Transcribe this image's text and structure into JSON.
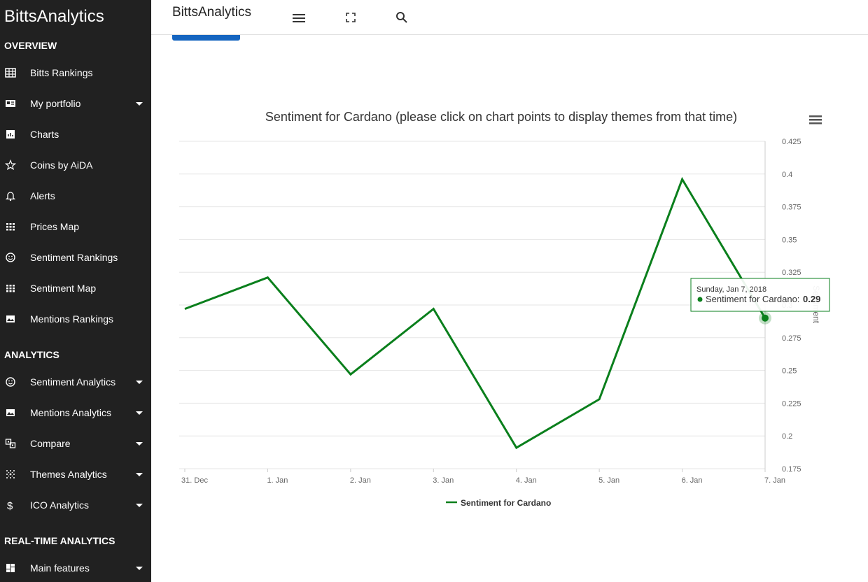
{
  "sidebar": {
    "brand": "BittsAnalytics",
    "sections": {
      "overview": "OVERVIEW",
      "analytics": "ANALYTICS",
      "realtime": "REAL-TIME ANALYTICS"
    },
    "overview_items": [
      {
        "label": "Bitts Rankings",
        "icon": "table-icon",
        "has_caret": false
      },
      {
        "label": "My portfolio",
        "icon": "id-card-icon",
        "has_caret": true
      },
      {
        "label": "Charts",
        "icon": "bar-chart-icon",
        "has_caret": false
      },
      {
        "label": "Coins by AiDA",
        "icon": "star-icon",
        "has_caret": false
      },
      {
        "label": "Alerts",
        "icon": "bell-icon",
        "has_caret": false
      },
      {
        "label": "Prices Map",
        "icon": "grid-dots-icon",
        "has_caret": false
      },
      {
        "label": "Sentiment Rankings",
        "icon": "smiley-icon",
        "has_caret": false
      },
      {
        "label": "Sentiment Map",
        "icon": "grid-dots-icon",
        "has_caret": false
      },
      {
        "label": "Mentions Rankings",
        "icon": "image-icon",
        "has_caret": false
      }
    ],
    "analytics_items": [
      {
        "label": "Sentiment Analytics",
        "icon": "smiley-icon",
        "has_caret": true
      },
      {
        "label": "Mentions Analytics",
        "icon": "image-icon",
        "has_caret": true
      },
      {
        "label": "Compare",
        "icon": "compare-icon",
        "has_caret": true
      },
      {
        "label": "Themes Analytics",
        "icon": "dots-grid-icon",
        "has_caret": true
      },
      {
        "label": "ICO Analytics",
        "icon": "dollar-icon",
        "has_caret": true
      }
    ],
    "realtime_items": [
      {
        "label": "Main features",
        "icon": "dashboard-icon",
        "has_caret": true
      }
    ]
  },
  "topbar": {
    "title": "BittsAnalytics",
    "icons": [
      "menu-icon",
      "fullscreen-icon",
      "search-icon"
    ]
  },
  "colors": {
    "sidebar_bg": "#212121",
    "series_color": "#0a7f1c",
    "accent_blue": "#1565c0"
  },
  "chart_data": {
    "type": "line",
    "title": "Sentiment for Cardano (please click on chart points to display themes from that time)",
    "ylabel": "Sentiment",
    "x": [
      "31. Dec",
      "1. Jan",
      "2. Jan",
      "3. Jan",
      "4. Jan",
      "5. Jan",
      "6. Jan",
      "7. Jan"
    ],
    "series": [
      {
        "name": "Sentiment for Cardano",
        "values": [
          0.297,
          0.321,
          0.247,
          0.297,
          0.191,
          0.228,
          0.396,
          0.29
        ]
      }
    ],
    "yticks": [
      "0.175",
      "0.2",
      "0.225",
      "0.25",
      "0.275",
      "0.3",
      "0.325",
      "0.35",
      "0.375",
      "0.4",
      "0.425"
    ],
    "ylim": [
      0.175,
      0.425
    ],
    "y_axis_side": "right",
    "grid": true,
    "legend": "bottom-center",
    "tooltip": {
      "date": "Sunday, Jan 7, 2018",
      "series": "Sentiment for Cardano:",
      "value": "0.29"
    }
  }
}
